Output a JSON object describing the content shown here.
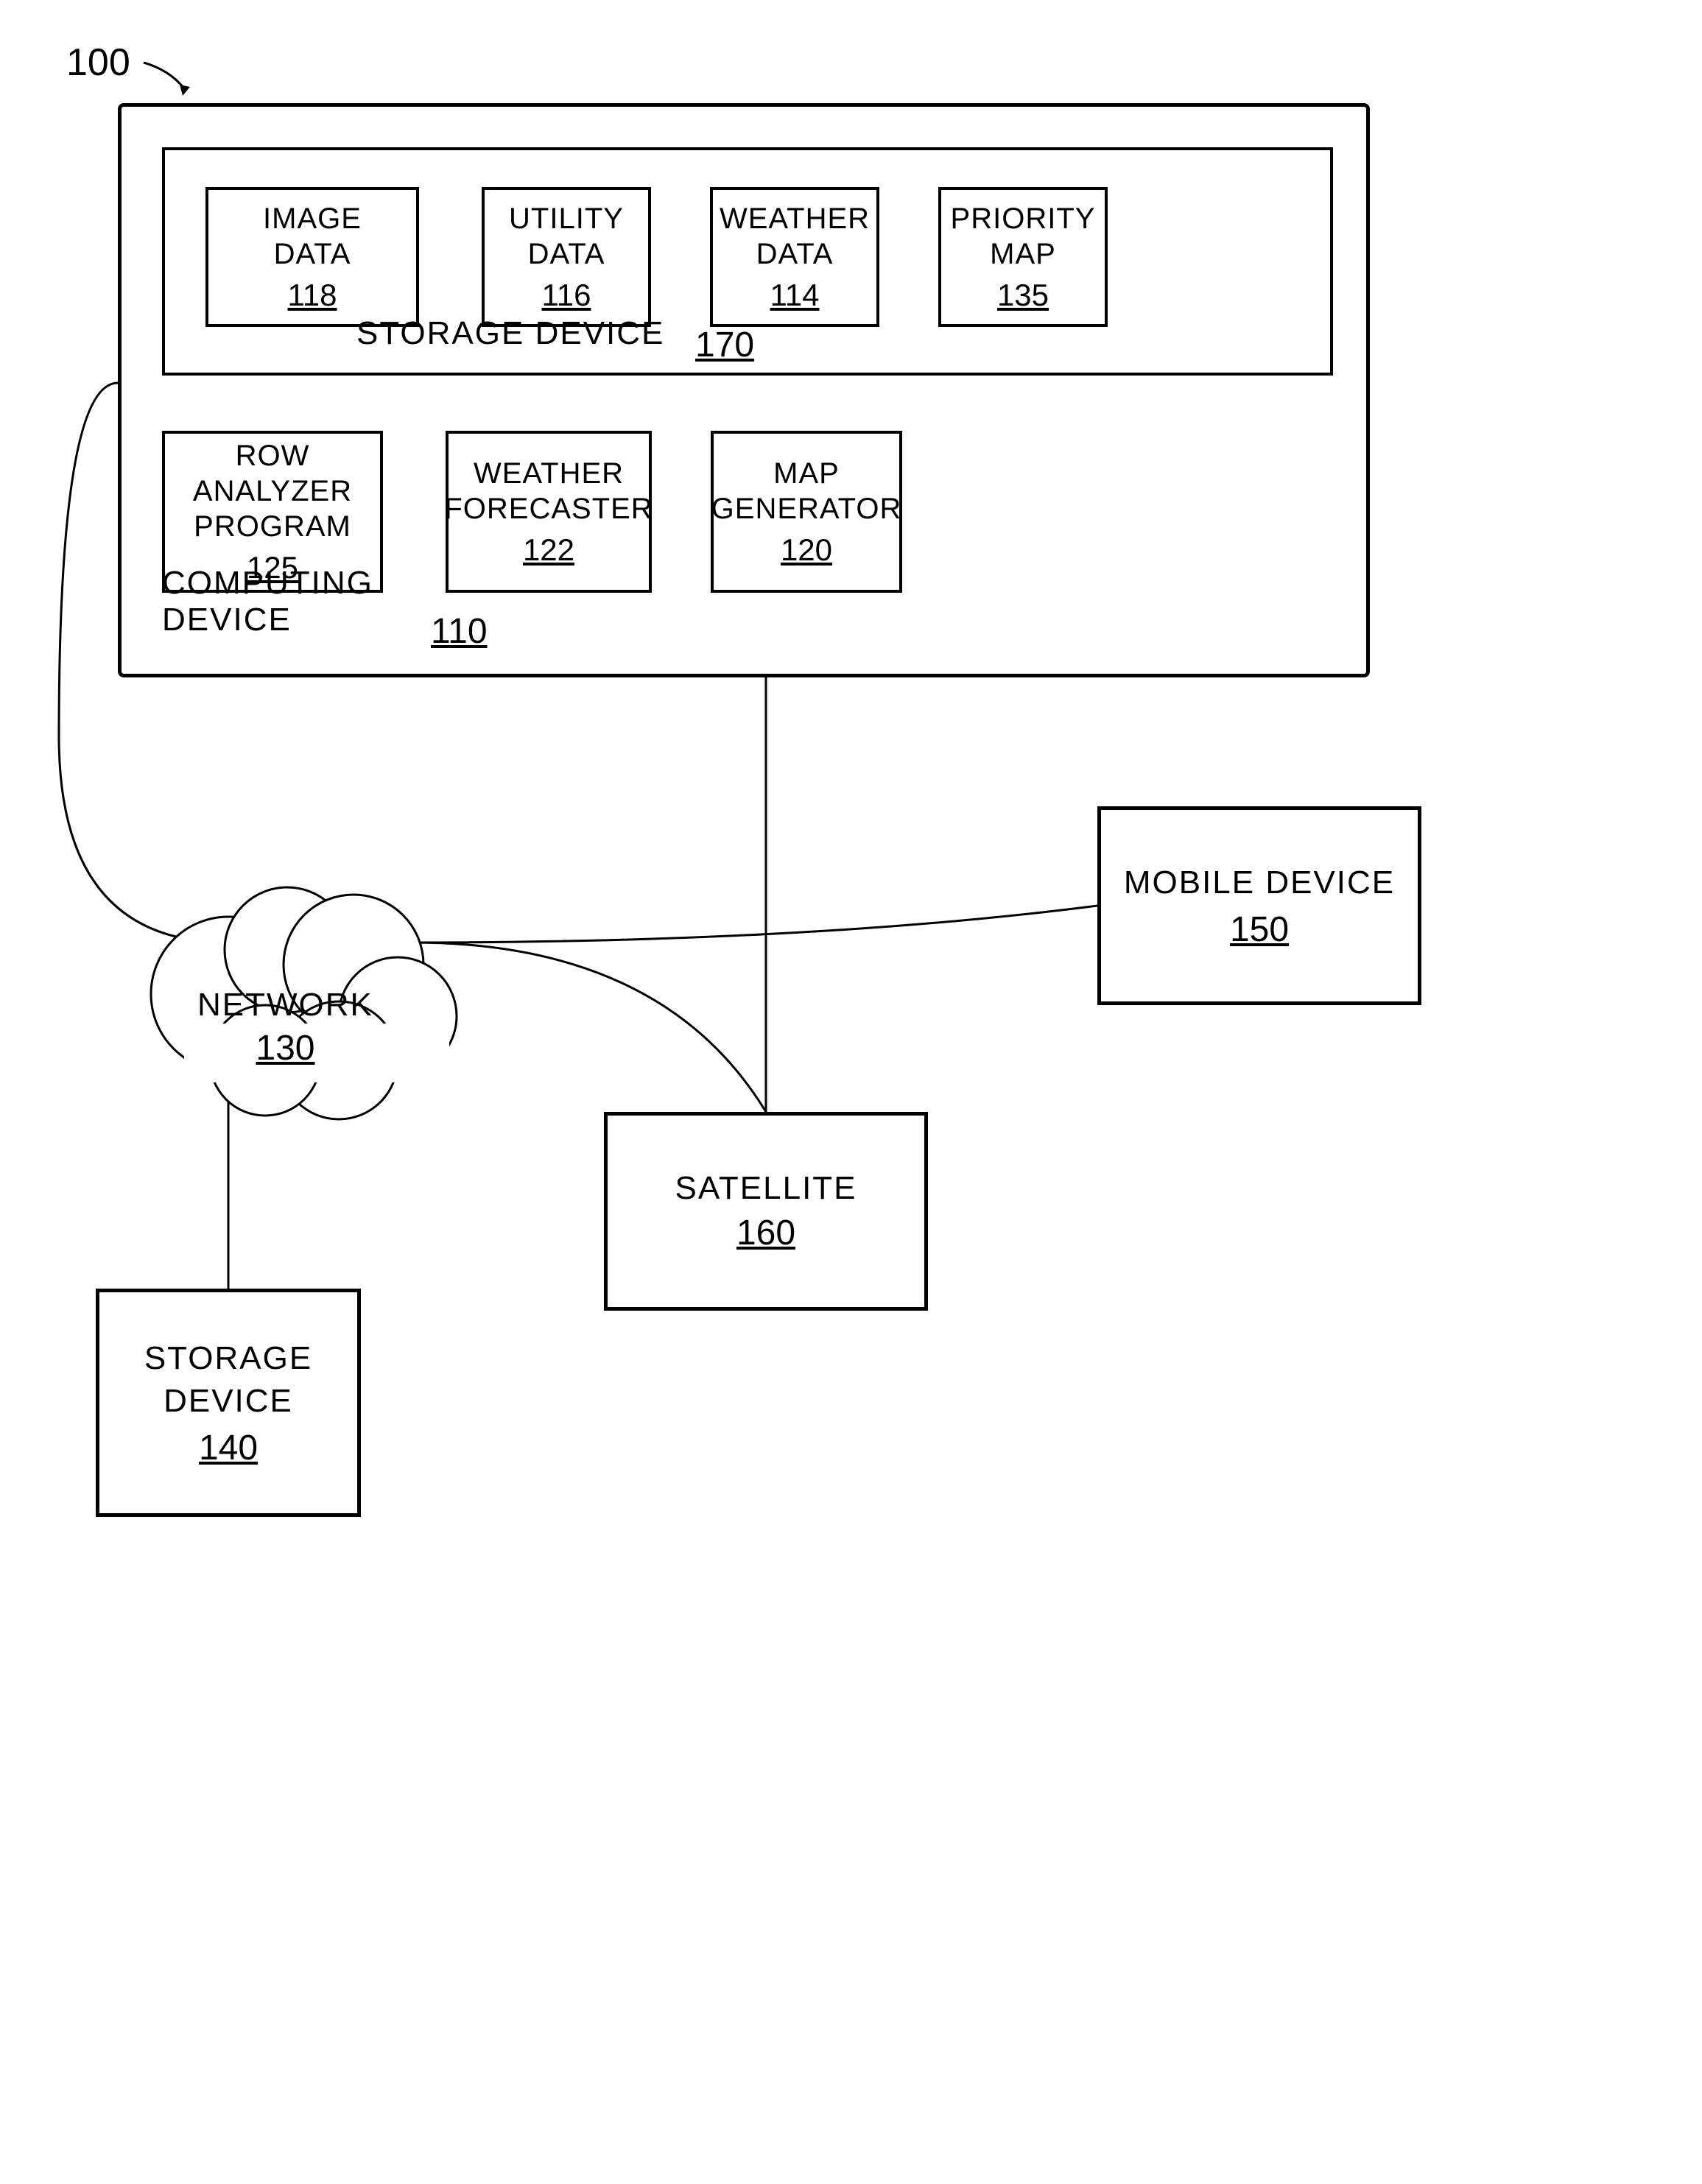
{
  "diagram": {
    "main_label": "100",
    "outer_box": {
      "computing_device": {
        "label": "COMPUTING\nDEVICE",
        "number": "110"
      },
      "storage_device": {
        "label": "STORAGE DEVICE",
        "number": "170",
        "data_boxes": [
          {
            "label": "IMAGE DATA",
            "number": "118"
          },
          {
            "label": "UTILITY\nDATA",
            "number": "116"
          },
          {
            "label": "WEATHER\nDATA",
            "number": "114"
          },
          {
            "label": "PRIORITY\nMAP",
            "number": "135"
          }
        ]
      },
      "program_boxes": [
        {
          "label": "ROW ANALYZER\nPROGRAM",
          "number": "125"
        },
        {
          "label": "WEATHER\nFORECASTER",
          "number": "122"
        },
        {
          "label": "MAP\nGENERATOR",
          "number": "120"
        }
      ]
    },
    "network": {
      "label": "NETWORK",
      "number": "130"
    },
    "mobile_device": {
      "label": "MOBILE DEVICE",
      "number": "150"
    },
    "satellite": {
      "label": "SATELLITE",
      "number": "160"
    },
    "storage_device_140": {
      "label": "STORAGE\nDEVICE",
      "number": "140"
    }
  }
}
